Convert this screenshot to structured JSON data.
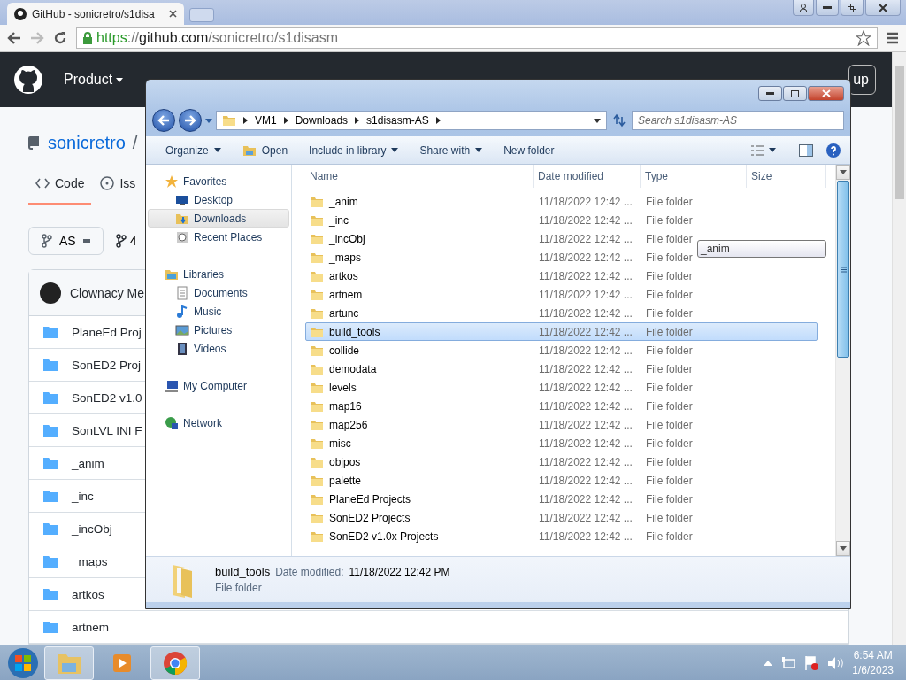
{
  "browser": {
    "tab": {
      "title": "GitHub - sonicretro/s1disa",
      "selected": true
    },
    "address": {
      "scheme": "https",
      "rest": "://",
      "host": "github.com",
      "path": "/sonicretro/s1disasm"
    }
  },
  "github": {
    "nav": [
      "Product"
    ],
    "signup": "up",
    "repo": {
      "owner": "sonicretro",
      "separator": "/"
    },
    "tabs": [
      {
        "label": "Code",
        "selected": true
      },
      {
        "label": "Iss",
        "selected": false
      }
    ],
    "branch": "AS",
    "branch_count": "4",
    "commit_author": "Clownacy Me",
    "files": [
      "PlaneEd Proj",
      "SonED2 Proj",
      "SonED2 v1.0",
      "SonLVL INI F",
      "_anim",
      "_inc",
      "_incObj",
      "_maps",
      "artkos",
      "artnem"
    ]
  },
  "explorer": {
    "breadcrumb": [
      "VM1",
      "Downloads",
      "s1disasm-AS"
    ],
    "search": {
      "placeholder": "Search s1disasm-AS"
    },
    "toolbar": [
      {
        "label": "Organize",
        "dropdown": true,
        "kind": "plain"
      },
      {
        "label": "Open",
        "dropdown": false,
        "kind": "open"
      },
      {
        "label": "Include in library",
        "dropdown": true,
        "kind": "plain"
      },
      {
        "label": "Share with",
        "dropdown": true,
        "kind": "plain"
      },
      {
        "label": "New folder",
        "dropdown": false,
        "kind": "plain"
      }
    ],
    "nav": [
      {
        "label": "Favorites",
        "kind": "star",
        "children": [
          {
            "label": "Desktop",
            "kind": "desktop",
            "selected": false
          },
          {
            "label": "Downloads",
            "kind": "downloads",
            "selected": true
          },
          {
            "label": "Recent Places",
            "kind": "recent",
            "selected": false
          }
        ]
      },
      {
        "label": "Libraries",
        "kind": "library",
        "children": [
          {
            "label": "Documents",
            "kind": "document",
            "selected": false
          },
          {
            "label": "Music",
            "kind": "music",
            "selected": false
          },
          {
            "label": "Pictures",
            "kind": "pictures",
            "selected": false
          },
          {
            "label": "Videos",
            "kind": "videos",
            "selected": false
          }
        ]
      },
      {
        "label": "My Computer",
        "kind": "computer"
      },
      {
        "label": "Network",
        "kind": "network"
      }
    ],
    "columns": [
      "Name",
      "Date modified",
      "Type",
      "Size"
    ],
    "rows": [
      {
        "name": "_anim",
        "date": "11/18/2022 12:42 ...",
        "type": "File folder",
        "selected": false
      },
      {
        "name": "_inc",
        "date": "11/18/2022 12:42 ...",
        "type": "File folder",
        "selected": false
      },
      {
        "name": "_incObj",
        "date": "11/18/2022 12:42 ...",
        "type": "File folder",
        "selected": false
      },
      {
        "name": "_maps",
        "date": "11/18/2022 12:42 ...",
        "type": "File folder",
        "selected": false
      },
      {
        "name": "artkos",
        "date": "11/18/2022 12:42 ...",
        "type": "File folder",
        "selected": false
      },
      {
        "name": "artnem",
        "date": "11/18/2022 12:42 ...",
        "type": "File folder",
        "selected": false
      },
      {
        "name": "artunc",
        "date": "11/18/2022 12:42 ...",
        "type": "File folder",
        "selected": false
      },
      {
        "name": "build_tools",
        "date": "11/18/2022 12:42 ...",
        "type": "File folder",
        "selected": true
      },
      {
        "name": "collide",
        "date": "11/18/2022 12:42 ...",
        "type": "File folder",
        "selected": false
      },
      {
        "name": "demodata",
        "date": "11/18/2022 12:42 ...",
        "type": "File folder",
        "selected": false
      },
      {
        "name": "levels",
        "date": "11/18/2022 12:42 ...",
        "type": "File folder",
        "selected": false
      },
      {
        "name": "map16",
        "date": "11/18/2022 12:42 ...",
        "type": "File folder",
        "selected": false
      },
      {
        "name": "map256",
        "date": "11/18/2022 12:42 ...",
        "type": "File folder",
        "selected": false
      },
      {
        "name": "misc",
        "date": "11/18/2022 12:42 ...",
        "type": "File folder",
        "selected": false
      },
      {
        "name": "objpos",
        "date": "11/18/2022 12:42 ...",
        "type": "File folder",
        "selected": false
      },
      {
        "name": "palette",
        "date": "11/18/2022 12:42 ...",
        "type": "File folder",
        "selected": false
      },
      {
        "name": "PlaneEd Projects",
        "date": "11/18/2022 12:42 ...",
        "type": "File folder",
        "selected": false
      },
      {
        "name": "SonED2 Projects",
        "date": "11/18/2022 12:42 ...",
        "type": "File folder",
        "selected": false
      },
      {
        "name": "SonED2 v1.0x Projects",
        "date": "11/18/2022 12:42 ...",
        "type": "File folder",
        "selected": false
      }
    ],
    "tooltip": "_anim",
    "details": {
      "name": "build_tools",
      "date_label": "Date modified:",
      "date": "11/18/2022 12:42 PM",
      "type": "File folder"
    }
  },
  "taskbar": {
    "apps": [
      {
        "kind": "explorer",
        "selected": true
      },
      {
        "kind": "media",
        "selected": false
      },
      {
        "kind": "chrome",
        "selected": true
      }
    ],
    "time": "6:54 AM",
    "date": "1/6/2023"
  }
}
